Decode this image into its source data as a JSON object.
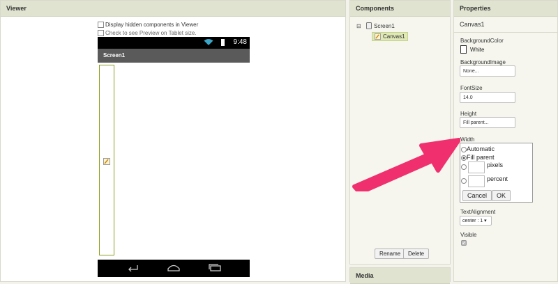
{
  "viewer": {
    "title": "Viewer",
    "hidden_components_label": "Display hidden components in Viewer",
    "tablet_preview_label": "Check to see Preview on Tablet size.",
    "phone": {
      "time": "9:48",
      "screen_title": "Screen1"
    }
  },
  "components": {
    "title": "Components",
    "tree": {
      "toggle": "⊟",
      "root": "Screen1",
      "child": "Canvas1"
    },
    "rename_label": "Rename",
    "delete_label": "Delete"
  },
  "media": {
    "title": "Media"
  },
  "properties": {
    "title": "Properties",
    "component_name": "Canvas1",
    "background_color_label": "BackgroundColor",
    "background_color_value": "White",
    "background_image_label": "BackgroundImage",
    "background_image_value": "None...",
    "font_size_label": "FontSize",
    "font_size_value": "14.0",
    "height_label": "Height",
    "height_value": "Fill parent...",
    "width_label": "Width",
    "width_options": {
      "automatic": "Automatic",
      "fill_parent": "Fill parent",
      "pixels": "pixels",
      "percent": "percent",
      "selected": "Fill parent"
    },
    "cancel_label": "Cancel",
    "ok_label": "OK",
    "text_alignment_label": "TextAlignment",
    "text_alignment_value": "center : 1 ▾",
    "visible_label": "Visible",
    "visible_checked": true
  },
  "colors": {
    "panel_header": "#dfe3cf",
    "canvas_border": "#8aa11e",
    "selected_node": "#dfe8b6",
    "arrow": "#f0306e"
  },
  "icons": {
    "wifi": "wifi-icon",
    "battery": "battery-icon",
    "back": "back-icon",
    "home": "home-icon",
    "recents": "recents-icon",
    "screen": "screen-icon",
    "canvas": "canvas-icon",
    "checkmark": "✔"
  }
}
